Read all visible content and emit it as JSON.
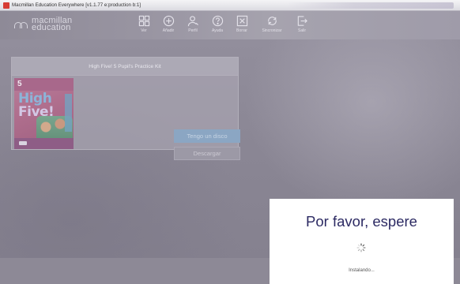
{
  "window": {
    "title": "Macmillan Education Everywhere [v1.1.77 e:production b:1]"
  },
  "brand": {
    "line1": "macmillan",
    "line2": "education"
  },
  "nav": {
    "items": [
      {
        "label": "Ver",
        "icon": "grid-icon"
      },
      {
        "label": "Añadir",
        "icon": "plus-circle-icon"
      },
      {
        "label": "Perfil",
        "icon": "user-icon"
      },
      {
        "label": "Ayuda",
        "icon": "help-icon"
      },
      {
        "label": "Borrar",
        "icon": "delete-icon"
      },
      {
        "label": "Sincronizar",
        "icon": "sync-icon"
      },
      {
        "label": "Salir",
        "icon": "exit-icon"
      }
    ]
  },
  "book": {
    "title": "High Five! 5 Pupil's Practice Kit",
    "cover_text": {
      "number": "5",
      "line1": "High",
      "line2": "Five!"
    },
    "actions": {
      "disk": "Tengo un disco",
      "download": "Descargar"
    }
  },
  "modal": {
    "heading": "Por favor, espere",
    "status": "Instalando..."
  },
  "colors": {
    "modal_heading": "#2c2a63",
    "primary_button": "#8ba6c3"
  }
}
